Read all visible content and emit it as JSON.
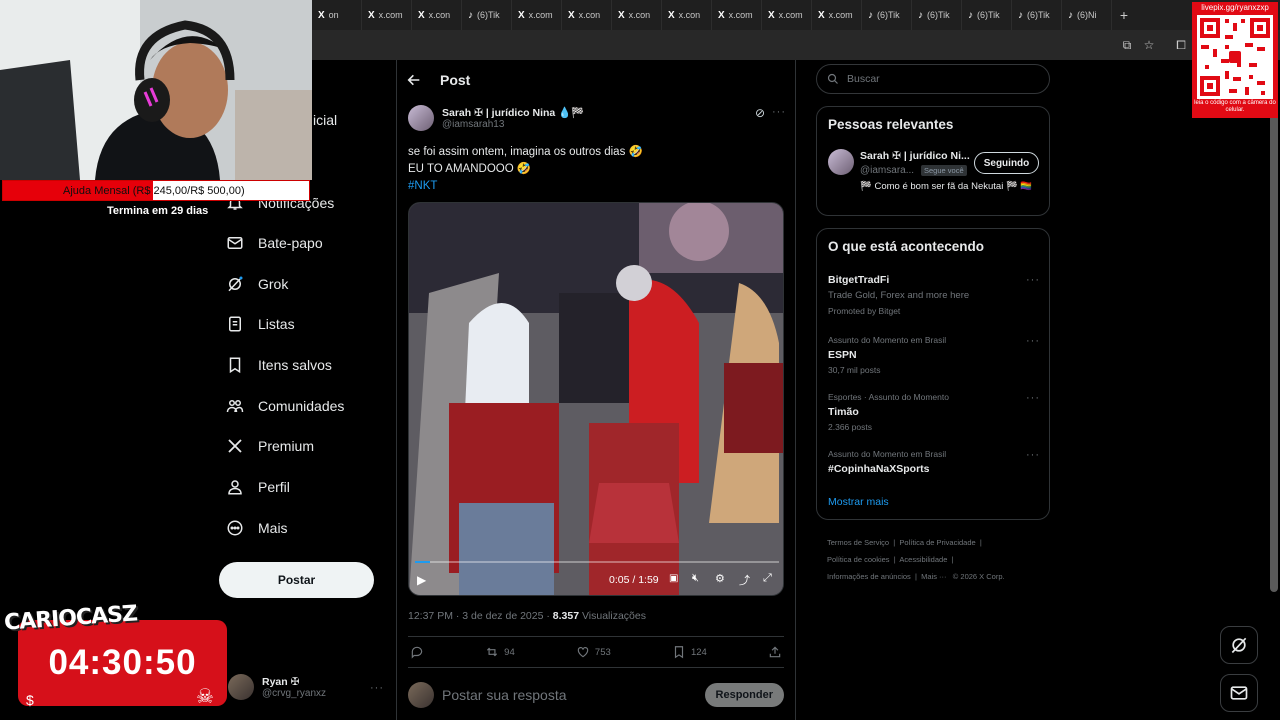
{
  "browser": {
    "tabs": [
      {
        "icon": "X",
        "label": "on"
      },
      {
        "icon": "X",
        "label": "x.com"
      },
      {
        "icon": "X",
        "label": "x.con"
      },
      {
        "icon": "♪",
        "label": "(6)Tik"
      },
      {
        "icon": "X",
        "label": "x.com"
      },
      {
        "icon": "X",
        "label": "x.con"
      },
      {
        "icon": "X",
        "label": "x.con"
      },
      {
        "icon": "X",
        "label": "x.con"
      },
      {
        "icon": "X",
        "label": "x.com"
      },
      {
        "icon": "X",
        "label": "x.com"
      },
      {
        "icon": "X",
        "label": "x.com"
      },
      {
        "icon": "♪",
        "label": "(6)Tik"
      },
      {
        "icon": "♪",
        "label": "(6)Tik"
      },
      {
        "icon": "♪",
        "label": "(6)Tik"
      },
      {
        "icon": "♪",
        "label": "(6)Tik"
      },
      {
        "icon": "♪",
        "label": "(6)Ni"
      }
    ],
    "new_tab": "+"
  },
  "nav": {
    "partial_top": "icial",
    "notifications": "Notificações",
    "chat": "Bate-papo",
    "grok": "Grok",
    "lists": "Listas",
    "bookmarks": "Itens salvos",
    "communities": "Comunidades",
    "premium": "Premium",
    "profile": "Perfil",
    "more": "Mais",
    "post_button": "Postar",
    "account": {
      "name": "Ryan ✠",
      "handle": "@crvg_ryanxz"
    }
  },
  "post": {
    "header_title": "Post",
    "author_name": "Sarah ✠ | jurídico Nina 💧🏁",
    "author_handle": "@iamsarah13",
    "text_line1": "se foi assim ontem, imagina os outros dias 🤣",
    "text_line2": "EU TO AMANDOOO 🤣",
    "hashtag": "#NKT",
    "video_time": "0:05 / 1:59",
    "video_progress": 0.04,
    "timestamp": "12:37 PM · 3 de dez de 2025 · ",
    "views_count": "8.357",
    "views_label": " Visualizações",
    "retweets": "94",
    "likes": "753",
    "bookmarks": "124",
    "reply_placeholder": "Postar sua resposta",
    "reply_button": "Responder"
  },
  "sidebar": {
    "search_placeholder": "Buscar",
    "relevant_title": "Pessoas relevantes",
    "relevant_user": {
      "name": "Sarah ✠ | jurídico Ni...",
      "handle": "@iamsara...",
      "follows_you": "Segue você",
      "bio": "🏁 Como é bom ser fã da Nekutai 🏁 🏳️‍🌈",
      "button": "Seguindo"
    },
    "trends_title": "O que está acontecendo",
    "trends": [
      {
        "meta": "",
        "name": "BitgetTradFi",
        "detail": "Trade Gold, Forex and more here",
        "extra": "Promoted by Bitget"
      },
      {
        "meta": "Assunto do Momento em Brasil",
        "name": "ESPN",
        "detail": "30,7 mil posts",
        "extra": ""
      },
      {
        "meta": "Esportes · Assunto do Momento",
        "name": "Timão",
        "detail": "2.366 posts",
        "extra": ""
      },
      {
        "meta": "Assunto do Momento em Brasil",
        "name": "#CopinhaNaXSports",
        "detail": "",
        "extra": ""
      }
    ],
    "show_more": "Mostrar mais",
    "footer": {
      "terms": "Termos de Serviço",
      "privacy": "Política de Privacidade",
      "cookies": "Política de cookies",
      "accessibility": "Acessibilidade",
      "ads": "Informações de anúncios",
      "more": "Mais ···",
      "copyright": "© 2026 X Corp."
    }
  },
  "overlays": {
    "goal_text": "Ajuda Mensal (R$ 245,00/R$ 500,00)",
    "goal_fraction": 0.49,
    "goal_ends": "Termina em 29 dias",
    "timer": "04:30:50",
    "timer_tag": "CARIOCASZ",
    "qr_label": "livepix.gg/ryanxzxp",
    "qr_caption": "leia o código com a câmera do celular."
  },
  "colors": {
    "accent": "#1d9bf0",
    "background": "#000000",
    "overlay_red": "#e10a14"
  }
}
